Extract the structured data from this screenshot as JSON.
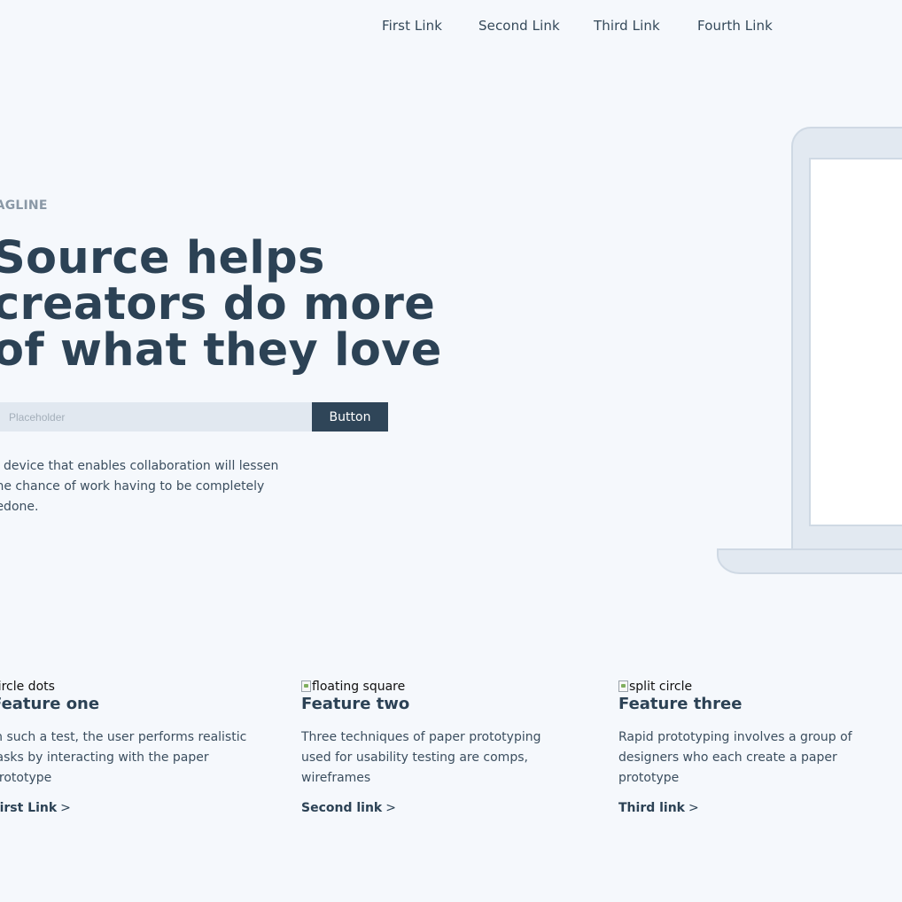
{
  "nav": {
    "links": [
      "First Link",
      "Second Link",
      "Third Link",
      "Fourth Link"
    ]
  },
  "hero": {
    "tagline": "TAGLINE",
    "headline_lines": [
      "Source helps",
      "creators do more",
      "of what they love"
    ],
    "input_placeholder": "Placeholder",
    "button_label": "Button",
    "description": "A device that enables collaboration will lessen the chance of work having to be completely redone."
  },
  "features": [
    {
      "image_alt": "circle dots",
      "title": "Feature one",
      "text": "In such a test, the user performs realistic tasks by interacting with the paper prototype",
      "link": "First Link",
      "link_arrow": ">"
    },
    {
      "image_alt": "floating square",
      "title": "Feature two",
      "text": "Three techniques of paper prototyping used for usability testing are comps, wireframes",
      "link": "Second link",
      "link_arrow": ">"
    },
    {
      "image_alt": "split circle",
      "title": "Feature three",
      "text": "Rapid prototyping involves a group of designers who each create a paper prototype",
      "link": "Third link",
      "link_arrow": ">"
    }
  ],
  "colors": {
    "background": "#f5f8fc",
    "text_dark": "#2c4255",
    "button_bg": "#2f4558",
    "input_bg": "#e1e8f0",
    "tagline": "#8a98a6",
    "device_fill": "#e2e9f1",
    "device_stroke": "#cfd9e4"
  }
}
